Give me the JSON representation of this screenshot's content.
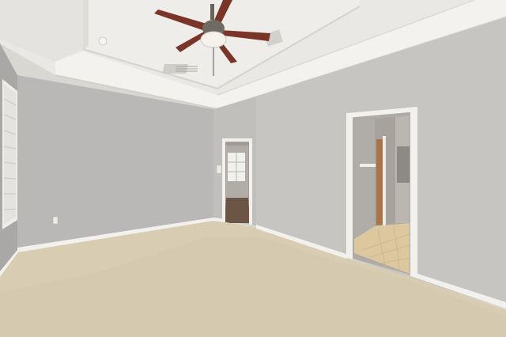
{
  "scene": {
    "kind": "empty-bedroom-interior",
    "features": [
      "tray-ceiling",
      "ceiling-fan",
      "ceiling-vent",
      "window-with-blinds",
      "open-doorway-hall",
      "open-doorway-bathroom",
      "carpet-floor",
      "tile-floor",
      "wall-outlet",
      "baseboards"
    ]
  },
  "colors": {
    "wall": "#b9b8b6",
    "wall_light": "#c9c8c5",
    "wall_shadow": "#a9a8a6",
    "ceiling": "#eeede9",
    "ceiling_tray": "#f4f3ef",
    "trim": "#f2f1ed",
    "carpet": "#d8ccb2",
    "carpet_shadow": "#cbbf a5",
    "tile": "#dcc79e",
    "fan_blade": "#7b3428",
    "fan_metal": "#6b6358",
    "door_wood": "#a9744a"
  }
}
